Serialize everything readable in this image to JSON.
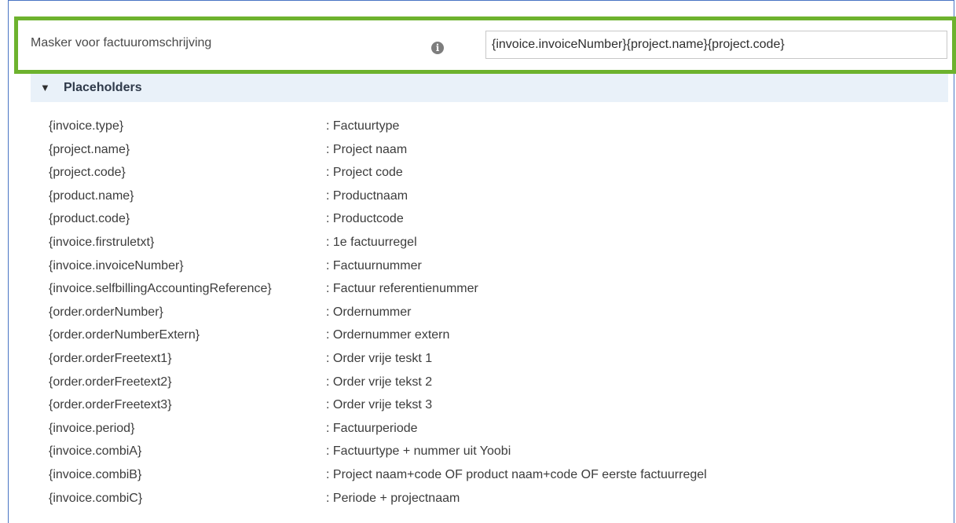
{
  "mask_field": {
    "label": "Masker voor factuuromschrijving",
    "info_icon": "info-icon",
    "value": "{invoice.invoiceNumber}{project.name}{project.code}"
  },
  "placeholders": {
    "toggle_icon": "triangle-down-icon",
    "title": "Placeholders",
    "items": [
      {
        "key": "{invoice.type}",
        "description": ": Factuurtype"
      },
      {
        "key": "{project.name}",
        "description": ": Project naam"
      },
      {
        "key": "{project.code}",
        "description": ": Project code"
      },
      {
        "key": "{product.name}",
        "description": ": Productnaam"
      },
      {
        "key": "{product.code}",
        "description": ": Productcode"
      },
      {
        "key": "{invoice.firstruletxt}",
        "description": ": 1e factuurregel"
      },
      {
        "key": "{invoice.invoiceNumber}",
        "description": ": Factuurnummer"
      },
      {
        "key": "{invoice.selfbillingAccountingReference}",
        "description": ": Factuur referentienummer"
      },
      {
        "key": "{order.orderNumber}",
        "description": ": Ordernummer"
      },
      {
        "key": "{order.orderNumberExtern}",
        "description": ": Ordernummer extern"
      },
      {
        "key": "{order.orderFreetext1}",
        "description": ": Order vrije teskt 1"
      },
      {
        "key": "{order.orderFreetext2}",
        "description": ": Order vrije tekst 2"
      },
      {
        "key": "{order.orderFreetext3}",
        "description": ": Order vrije tekst 3"
      },
      {
        "key": "{invoice.period}",
        "description": ": Factuurperiode"
      },
      {
        "key": "{invoice.combiA}",
        "description": ": Factuurtype + nummer uit Yoobi"
      },
      {
        "key": "{invoice.combiB}",
        "description": ": Project naam+code OF product naam+code OF eerste factuurregel"
      },
      {
        "key": "{invoice.combiC}",
        "description": ": Periode + projectnaam"
      }
    ]
  },
  "colors": {
    "highlight_border": "#6db22e",
    "frame_border": "#4a74c4",
    "header_background": "#e9f1f9"
  }
}
